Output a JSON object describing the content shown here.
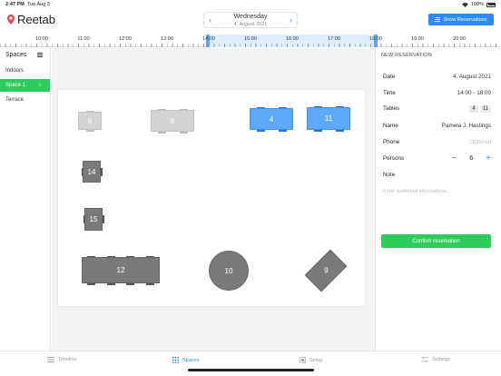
{
  "status_bar": {
    "time": "2:47 PM",
    "date": "Tue Aug 3",
    "battery": "100%"
  },
  "app": {
    "name": "Reetab"
  },
  "header": {
    "weekday": "Wednesday",
    "date": "4. August 2021",
    "prev_icon": "chevron-left-icon",
    "next_icon": "chevron-right-icon",
    "show_reservations": "Show Reservations"
  },
  "timeline": {
    "hours": [
      "10:00",
      "11:00",
      "12:00",
      "13:00",
      "14:00",
      "15:00",
      "16:00",
      "17:00",
      "18:00",
      "19:00",
      "20:00"
    ]
  },
  "sidebar": {
    "title": "Spaces",
    "items": [
      {
        "label": "Indoors",
        "active": false
      },
      {
        "label": "Space 1",
        "active": true
      },
      {
        "label": "Terrace",
        "active": false
      }
    ]
  },
  "tables": [
    {
      "label": "6",
      "state": "unavailable"
    },
    {
      "label": "8",
      "state": "unavailable"
    },
    {
      "label": "4",
      "state": "selected"
    },
    {
      "label": "11",
      "state": "selected"
    },
    {
      "label": "14",
      "state": "available"
    },
    {
      "label": "15",
      "state": "available"
    },
    {
      "label": "12",
      "state": "available"
    },
    {
      "label": "10",
      "state": "available"
    },
    {
      "label": "9",
      "state": "available"
    }
  ],
  "reservation": {
    "title": "NEW RESERVATION",
    "date_label": "Date",
    "date_value": "4. August 2021",
    "time_label": "Time",
    "time_value": "14:00 - 18:00",
    "tables_label": "Tables",
    "tables_values": [
      "4",
      "11"
    ],
    "name_label": "Name",
    "name_value": "Pamela J. Hastings",
    "phone_label": "Phone",
    "phone_placeholder": "Optional",
    "persons_label": "Persons",
    "persons_value": "6",
    "note_label": "Note",
    "note_placeholder": "Enter additional informations...",
    "confirm": "Confirm reservation"
  },
  "tabbar": [
    {
      "label": "Timeline",
      "icon": "timeline-icon",
      "active": false
    },
    {
      "label": "Spaces",
      "icon": "grid-icon",
      "active": true
    },
    {
      "label": "Setup",
      "icon": "setup-icon",
      "active": false
    },
    {
      "label": "Settings",
      "icon": "sliders-icon",
      "active": false
    }
  ],
  "colors": {
    "accent_blue": "#2d8cf0",
    "accent_green": "#2ecc5a",
    "selected_table": "#5ba9f7",
    "available_table": "#7a7a7a",
    "unavailable_table": "#d4d4d4"
  }
}
